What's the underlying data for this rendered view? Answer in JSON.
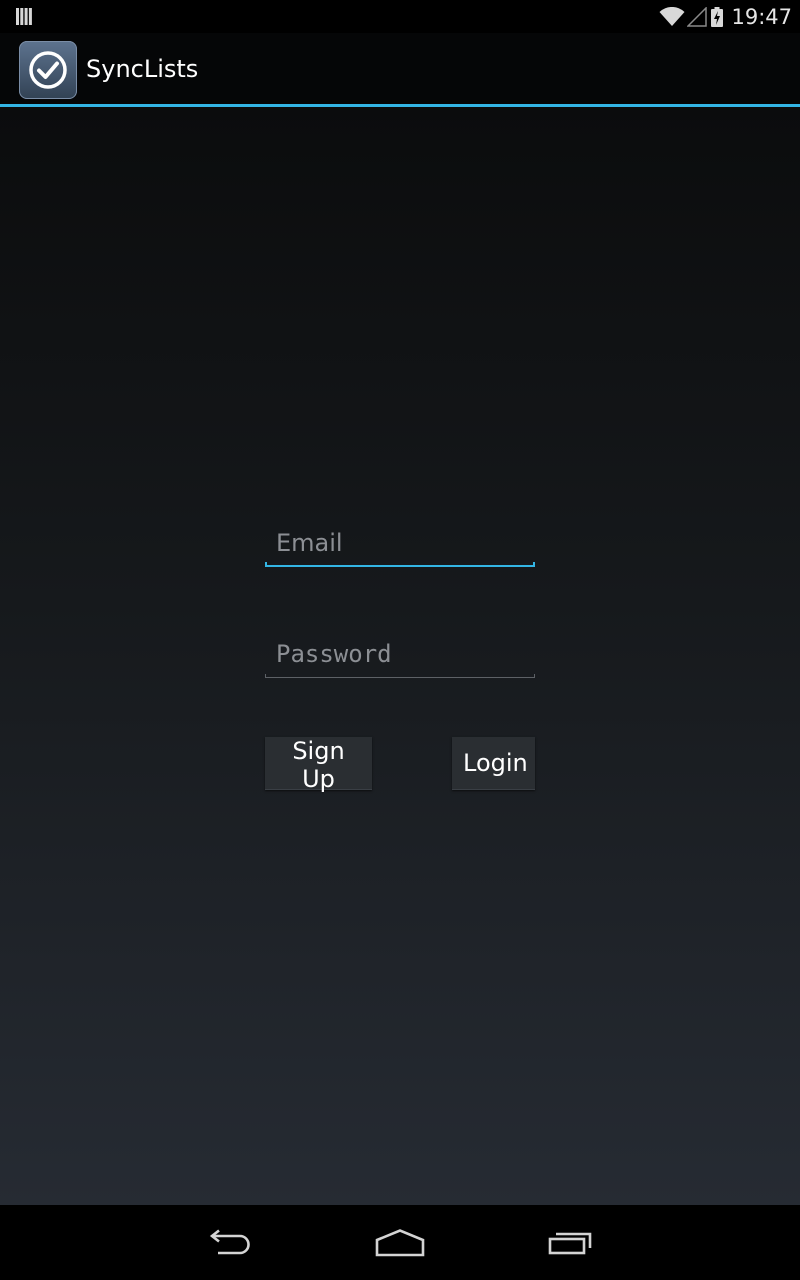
{
  "status_bar": {
    "time": "19:47",
    "icons": [
      "notification-bars-icon",
      "wifi-icon",
      "signal-icon",
      "battery-charging-icon"
    ]
  },
  "action_bar": {
    "app_icon": "checkmark-circle-icon",
    "title": "SyncLists",
    "accent_color": "#33b5e5"
  },
  "form": {
    "email_placeholder": "Email",
    "email_value": "",
    "password_placeholder": "Password",
    "password_value": "",
    "signup_label": "Sign Up",
    "login_label": "Login"
  },
  "nav_bar": {
    "icons": [
      "back-icon",
      "home-icon",
      "recent-apps-icon"
    ]
  }
}
